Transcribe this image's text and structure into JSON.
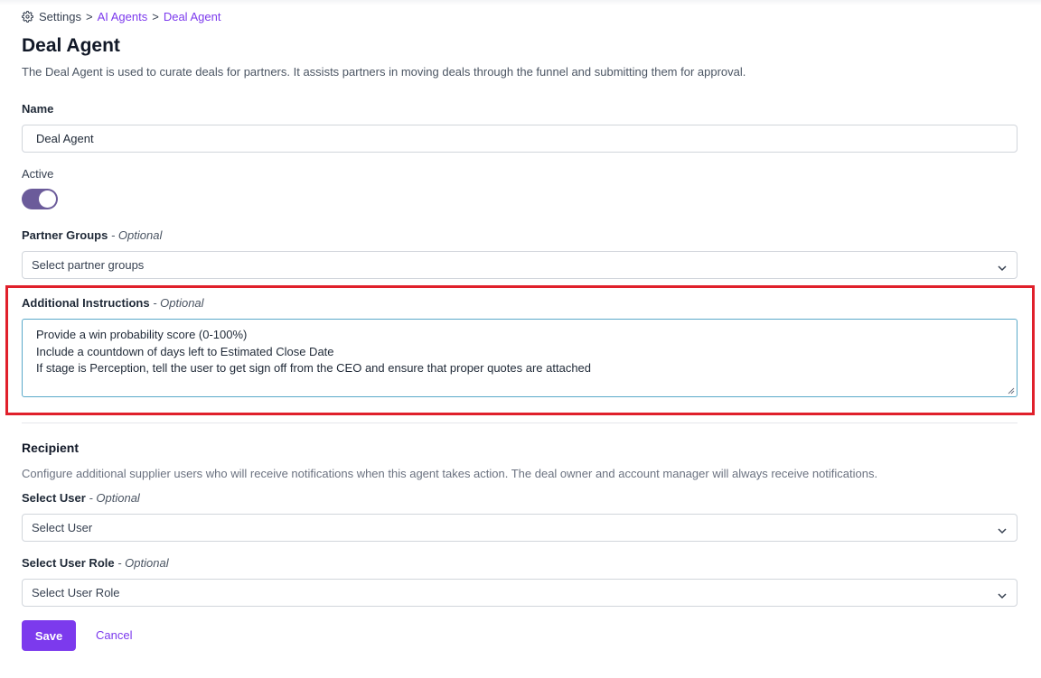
{
  "breadcrumb": {
    "settings": "Settings",
    "separator": ">",
    "ai_agents": "AI Agents",
    "current": "Deal Agent",
    "icon": "gear-icon"
  },
  "header": {
    "title": "Deal Agent",
    "description": "The Deal Agent is used to curate deals for partners. It assists partners in moving deals through the funnel and submitting them for approval."
  },
  "form": {
    "name": {
      "label": "Name",
      "value": "Deal Agent"
    },
    "active": {
      "label": "Active",
      "checked": true
    },
    "partner_groups": {
      "label": "Partner Groups",
      "optional": "- Optional",
      "placeholder": "Select partner groups"
    },
    "additional_instructions": {
      "label": "Additional Instructions",
      "optional": "- Optional",
      "lines": [
        "Provide a win probability score (0-100%)",
        "Include a countdown of days left to Estimated Close Date",
        "If stage is Perception, tell the user to get sign off from the CEO and ensure that proper quotes are attached"
      ]
    }
  },
  "recipient": {
    "title": "Recipient",
    "description": "Configure additional supplier users who will receive notifications when this agent takes action. The deal owner and account manager will always receive notifications.",
    "select_user": {
      "label": "Select User",
      "optional": "- Optional",
      "placeholder": "Select User"
    },
    "select_user_role": {
      "label": "Select User Role",
      "optional": "- Optional",
      "placeholder": "Select User Role"
    }
  },
  "actions": {
    "save": "Save",
    "cancel": "Cancel"
  },
  "colors": {
    "accent": "#7c3aed",
    "toggle_on": "#6b5b9a",
    "highlight": "#e0202b"
  }
}
